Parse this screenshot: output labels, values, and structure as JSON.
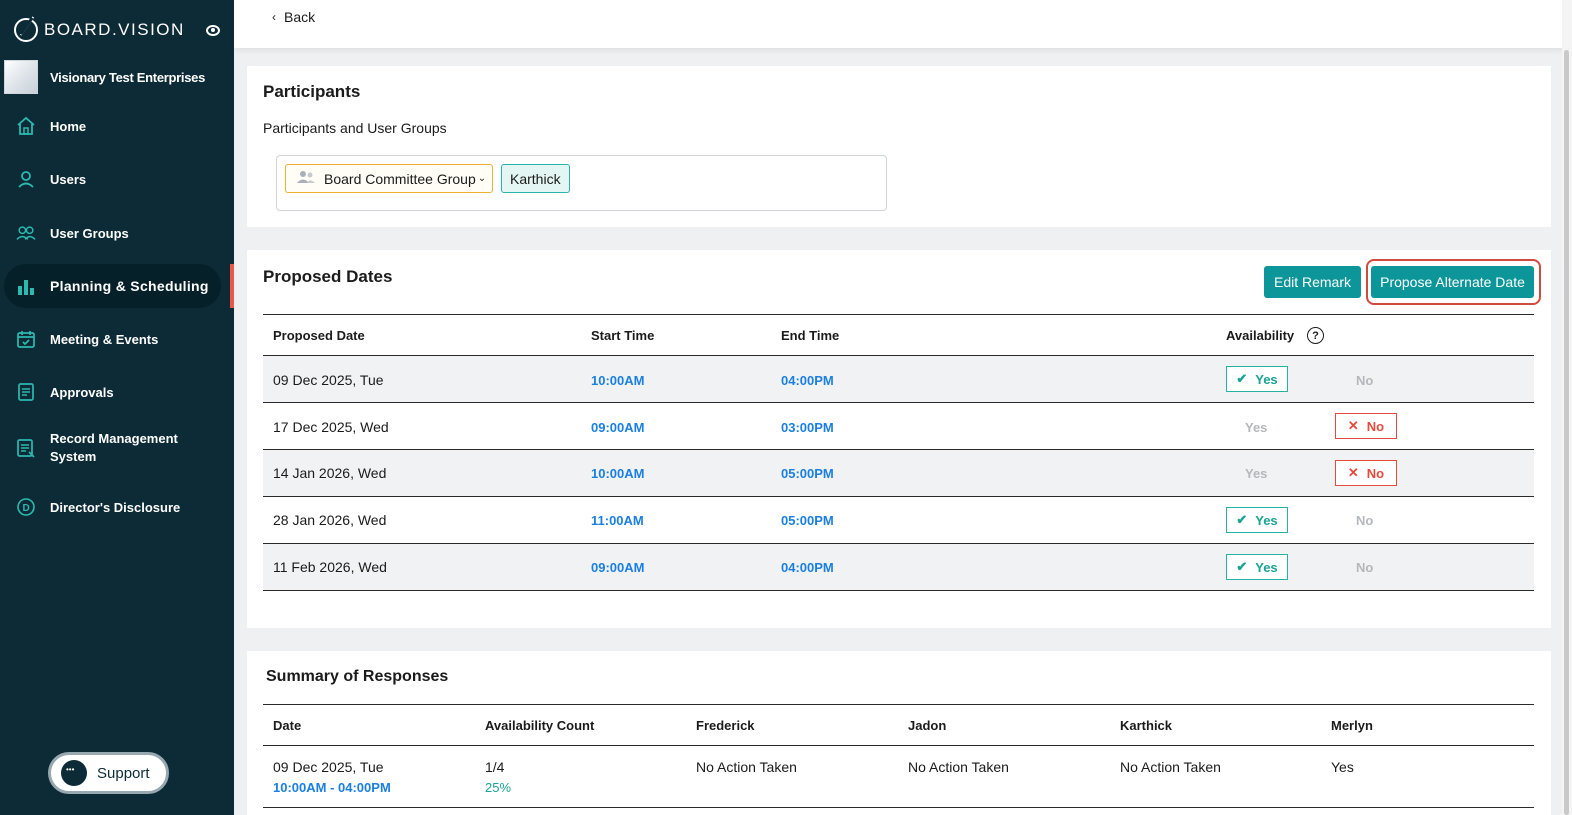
{
  "sidebar": {
    "brand": "BOARD.VISION",
    "org_name": "Visionary Test Enterprises",
    "items": [
      {
        "label": "Home",
        "icon": "home-icon"
      },
      {
        "label": "Users",
        "icon": "user-icon"
      },
      {
        "label": "User Groups",
        "icon": "user-groups-icon"
      },
      {
        "label": "Planning & Scheduling",
        "icon": "bar-chart-icon",
        "active": true
      },
      {
        "label": "Meeting & Events",
        "icon": "calendar-icon"
      },
      {
        "label": "Approvals",
        "icon": "document-icon"
      },
      {
        "label": "Record Management System",
        "label_line1": "Record Management",
        "label_line2": "System",
        "icon": "records-icon"
      },
      {
        "label": "Director's Disclosure",
        "icon": "disclosure-icon"
      }
    ],
    "support_label": "Support"
  },
  "topbar": {
    "back_label": "Back"
  },
  "participants": {
    "title": "Participants",
    "subtitle": "Participants and User Groups",
    "group_chip": "Board Committee Group",
    "user_chip": "Karthick"
  },
  "proposed_dates": {
    "title": "Proposed Dates",
    "edit_remark_label": "Edit Remark",
    "propose_alternate_label": "Propose Alternate Date",
    "columns": [
      "Proposed Date",
      "Start Time",
      "End Time",
      "Availability"
    ],
    "rows": [
      {
        "date": "09 Dec 2025, Tue",
        "start": "10:00AM",
        "end": "04:00PM",
        "yes": "Yes",
        "no": "No",
        "selected": "yes"
      },
      {
        "date": "17 Dec 2025, Wed",
        "start": "09:00AM",
        "end": "03:00PM",
        "yes": "Yes",
        "no": "No",
        "selected": "no"
      },
      {
        "date": "14 Jan 2026, Wed",
        "start": "10:00AM",
        "end": "05:00PM",
        "yes": "Yes",
        "no": "No",
        "selected": "no"
      },
      {
        "date": "28 Jan 2026, Wed",
        "start": "11:00AM",
        "end": "05:00PM",
        "yes": "Yes",
        "no": "No",
        "selected": "yes"
      },
      {
        "date": "11 Feb 2026, Wed",
        "start": "09:00AM",
        "end": "04:00PM",
        "yes": "Yes",
        "no": "No",
        "selected": "yes"
      }
    ]
  },
  "summary": {
    "title": "Summary of Responses",
    "columns": [
      "Date",
      "Availability Count",
      "Frederick",
      "Jadon",
      "Karthick",
      "Merlyn"
    ],
    "rows": [
      {
        "date": "09 Dec 2025, Tue",
        "time_range": "10:00AM - 04:00PM",
        "count": "1/4",
        "percent": "25%",
        "frederick": "No Action Taken",
        "jadon": "No Action Taken",
        "karthick": "No Action Taken",
        "merlyn": "Yes"
      }
    ]
  },
  "colors": {
    "sidebar_bg": "#0c2b36",
    "accent_teal": "#0c969a",
    "time_blue": "#1a7fe0",
    "no_red": "#e44a3e",
    "yes_green": "#1aa394",
    "highlight_red": "#d04a3d"
  }
}
